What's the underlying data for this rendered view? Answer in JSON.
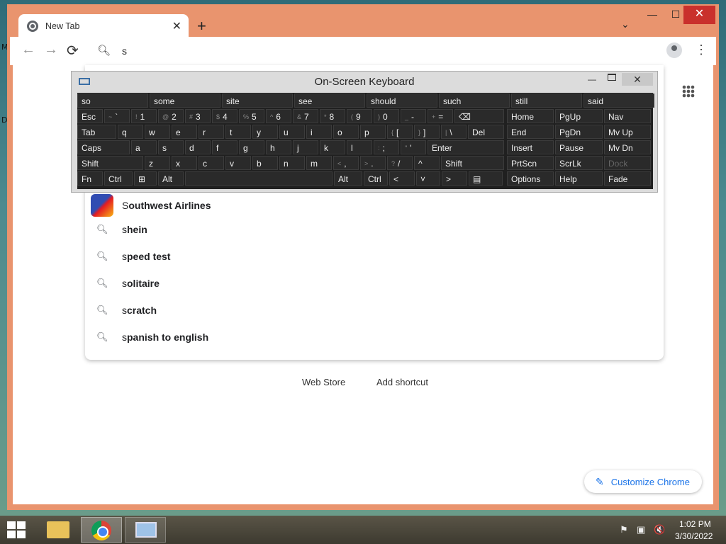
{
  "desktop": {
    "letters": [
      "M",
      "D"
    ]
  },
  "browser": {
    "tab_title": "New Tab",
    "tab_close": "✕",
    "new_tab": "+",
    "tab_menu": "⌄",
    "win_min": "—",
    "win_max": "☐",
    "win_close": "✕",
    "back": "←",
    "forward": "→",
    "reload": "⟳",
    "omnibox_text": "s",
    "menu": "⋮"
  },
  "suggestions": {
    "top": {
      "typed": "S",
      "rest": "outhwest Airlines"
    },
    "items": [
      {
        "typed": "s",
        "rest": "hein"
      },
      {
        "typed": "s",
        "rest": "peed test"
      },
      {
        "typed": "s",
        "rest": "olitaire"
      },
      {
        "typed": "s",
        "rest": "cratch"
      },
      {
        "typed": "s",
        "rest": "panish to english"
      }
    ]
  },
  "shortcuts": {
    "web_store": "Web Store",
    "add_shortcut": "Add shortcut"
  },
  "customize": {
    "label": "Customize Chrome",
    "icon": "pencil-icon"
  },
  "osk": {
    "title": "On-Screen Keyboard",
    "minimize": "—",
    "close": "✕",
    "predictions": [
      "so",
      "some",
      "site",
      "see",
      "should",
      "such",
      "still",
      "said"
    ],
    "row1": [
      {
        "label": "Esc"
      },
      {
        "shift": "~",
        "label": "`"
      },
      {
        "shift": "!",
        "label": "1"
      },
      {
        "shift": "@",
        "label": "2"
      },
      {
        "shift": "#",
        "label": "3"
      },
      {
        "shift": "$",
        "label": "4"
      },
      {
        "shift": "%",
        "label": "5"
      },
      {
        "shift": "^",
        "label": "6"
      },
      {
        "shift": "&",
        "label": "7"
      },
      {
        "shift": "*",
        "label": "8"
      },
      {
        "shift": "(",
        "label": "9"
      },
      {
        "shift": ")",
        "label": "0"
      },
      {
        "shift": "_",
        "label": "-"
      },
      {
        "shift": "+",
        "label": "="
      },
      {
        "label": "⌫"
      }
    ],
    "row2": [
      {
        "label": "Tab"
      },
      {
        "label": "q"
      },
      {
        "label": "w"
      },
      {
        "label": "e"
      },
      {
        "label": "r"
      },
      {
        "label": "t"
      },
      {
        "label": "y"
      },
      {
        "label": "u"
      },
      {
        "label": "i"
      },
      {
        "label": "o"
      },
      {
        "label": "p"
      },
      {
        "shift": "{",
        "label": "["
      },
      {
        "shift": "}",
        "label": "]"
      },
      {
        "shift": "|",
        "label": "\\"
      },
      {
        "label": "Del"
      }
    ],
    "row3": [
      {
        "label": "Caps"
      },
      {
        "label": "a"
      },
      {
        "label": "s"
      },
      {
        "label": "d"
      },
      {
        "label": "f"
      },
      {
        "label": "g"
      },
      {
        "label": "h"
      },
      {
        "label": "j"
      },
      {
        "label": "k"
      },
      {
        "label": "l"
      },
      {
        "shift": ":",
        "label": ";"
      },
      {
        "shift": "\"",
        "label": "'"
      },
      {
        "label": "Enter"
      }
    ],
    "row4": [
      {
        "label": "Shift"
      },
      {
        "label": "z"
      },
      {
        "label": "x"
      },
      {
        "label": "c"
      },
      {
        "label": "v"
      },
      {
        "label": "b"
      },
      {
        "label": "n"
      },
      {
        "label": "m"
      },
      {
        "shift": "<",
        "label": ","
      },
      {
        "shift": ">",
        "label": "."
      },
      {
        "shift": "?",
        "label": "/"
      },
      {
        "label": "^"
      },
      {
        "label": "Shift"
      }
    ],
    "row5": [
      {
        "label": "Fn"
      },
      {
        "label": "Ctrl"
      },
      {
        "label": "⊞"
      },
      {
        "label": "Alt"
      },
      {
        "label": ""
      },
      {
        "label": "Alt"
      },
      {
        "label": "Ctrl"
      },
      {
        "label": "<"
      },
      {
        "label": "˅"
      },
      {
        "label": ">"
      },
      {
        "label": "▤"
      }
    ],
    "nav_rows": [
      [
        "Home",
        "PgUp",
        "Nav"
      ],
      [
        "End",
        "PgDn",
        "Mv Up"
      ],
      [
        "Insert",
        "Pause",
        "Mv Dn"
      ],
      [
        "PrtScn",
        "ScrLk",
        "Dock"
      ],
      [
        "Options",
        "Help",
        "Fade"
      ]
    ]
  },
  "taskbar": {
    "time": "1:02 PM",
    "date": "3/30/2022",
    "tray": [
      "⚑",
      "▣",
      "🔇"
    ]
  }
}
